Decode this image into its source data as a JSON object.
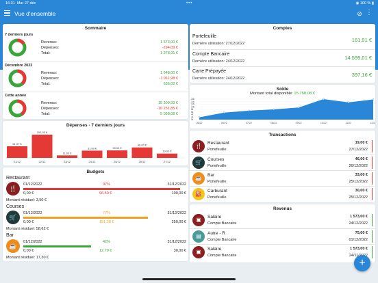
{
  "status": {
    "time": "16:31",
    "date": "Mar 27 déc",
    "dots": "•••",
    "battery": "100 %"
  },
  "appbar": {
    "title": "Vue d'ensemble",
    "notif_icon": "notifications-off-icon",
    "more_icon": "more-vertical-icon"
  },
  "sommaire": {
    "title": "Sommaire",
    "labels": {
      "revenus": "Revenus:",
      "depenses": "Dépenses:",
      "total": "Total:"
    },
    "periods": [
      {
        "name": "7 derniers jours",
        "revenus": "1 573,00 €",
        "depenses": "-294,09 €",
        "total": "1 278,91 €",
        "ratio": 0.16
      },
      {
        "name": "Décembre 2022",
        "revenus": "1 648,00 €",
        "depenses": "-1 011,98 €",
        "total": "636,02 €",
        "ratio": 0.38
      },
      {
        "name": "Cette année",
        "revenus": "15 309,93 €",
        "depenses": "-10 251,85 €",
        "total": "5 058,08 €",
        "ratio": 0.4
      }
    ]
  },
  "depenses": {
    "title": "Dépenses - 7 derniers jours",
    "chart_data": {
      "type": "bar",
      "categories": [
        "21/12",
        "22/12",
        "23/12",
        "24/12",
        "25/12",
        "26/12",
        "27/12"
      ],
      "values": [
        51.07,
        102.03,
        11.0,
        31.89,
        33.0,
        46.0,
        19.0
      ],
      "labels": [
        "51,07 €",
        "102,03 €",
        "11,00 €",
        "31,89 €",
        "33,00 €",
        "46,00 €",
        "19,00 €"
      ],
      "color": "#e53935"
    }
  },
  "budgets": {
    "title": "Budgets",
    "residuel_label": "Montant résiduel:",
    "items": [
      {
        "name": "Restaurant",
        "start": "01/12/2022",
        "end": "31/12/2022",
        "pct": "97%",
        "spent": "96,50 €",
        "min": "0,00 €",
        "total": "100,00 €",
        "residual": "3,50 €",
        "fill": 0.97,
        "color": "#e53935",
        "icon": "restaurant-icon",
        "icon_bg": "#8b1e1e"
      },
      {
        "name": "Courses",
        "start": "01/12/2022",
        "end": "31/12/2022",
        "pct": "77%",
        "spent": "191,38 €",
        "min": "0,00 €",
        "total": "250,00 €",
        "residual": "58,62 €",
        "fill": 0.77,
        "color": "#f0a020",
        "icon": "shopping-cart-icon",
        "icon_bg": "#1f3a3a"
      },
      {
        "name": "Bar",
        "start": "01/12/2022",
        "end": "31/12/2022",
        "pct": "42%",
        "spent": "12,70 €",
        "min": "0,00 €",
        "total": "30,00 €",
        "residual": "17,30 €",
        "fill": 0.42,
        "color": "#3aa53a",
        "icon": "coffee-icon",
        "icon_bg": "#ef8c1a"
      }
    ]
  },
  "comptes": {
    "title": "Comptes",
    "items": [
      {
        "name": "Portefeuille",
        "last": "Dernière utilisation: 27/12/2022",
        "value": "161,91 €"
      },
      {
        "name": "Compte Bancaire",
        "last": "Dernière utilisation: 24/12/2022",
        "value": "14 599,01 €"
      },
      {
        "name": "Carte Prépayée",
        "last": "Dernière utilisation: 24/12/2022",
        "value": "397,16 €"
      }
    ]
  },
  "solde": {
    "title": "Solde",
    "total_label": "Montant total disponible:",
    "total_value": "15 758,08 €",
    "chart_data": {
      "type": "area",
      "x": [
        "05/22",
        "06/22",
        "07/22",
        "08/22",
        "09/22",
        "10/22",
        "11/22",
        "12/22"
      ],
      "y": [
        1800,
        5500,
        7000,
        8000,
        9500,
        16000,
        13500,
        15758
      ],
      "ytick_labels": [
        "0k",
        "2k",
        "4k",
        "6k",
        "8k",
        "10k",
        "12k",
        "14k",
        "16k"
      ],
      "ylim": [
        0,
        16000
      ],
      "color": "#2a87d8"
    }
  },
  "transactions": {
    "title": "Transactions",
    "items": [
      {
        "name": "Restaurant",
        "account": "Portefeuille",
        "amount": "19,00 €",
        "date": "27/12/2022",
        "icon": "restaurant-icon",
        "icon_bg": "#8b1e1e",
        "color": "#e53935"
      },
      {
        "name": "Courses",
        "account": "Portefeuille",
        "amount": "46,00 €",
        "date": "26/12/2022",
        "icon": "shopping-cart-icon",
        "icon_bg": "#1f3a3a",
        "color": "#e53935"
      },
      {
        "name": "Bar",
        "account": "Portefeuille",
        "amount": "33,00 €",
        "date": "25/12/2022",
        "icon": "coffee-icon",
        "icon_bg": "#ef8c1a",
        "color": "#e53935"
      },
      {
        "name": "Carburant",
        "account": "Portefeuille",
        "amount": "30,00 €",
        "date": "25/12/2022",
        "icon": "fuel-icon",
        "icon_bg": "#f5c518",
        "color": "#e53935"
      }
    ]
  },
  "revenus": {
    "title": "Revenus",
    "items": [
      {
        "name": "Salaire",
        "account": "Compte Bancaire",
        "amount": "1 573,00 €",
        "date": "24/12/2022",
        "icon": "wallet-icon",
        "icon_bg": "#8b1e1e",
        "color": "#3aa53a"
      },
      {
        "name": "Autre - R",
        "account": "Compte Bancaire",
        "amount": "75,00 €",
        "date": "01/12/2022",
        "icon": "document-icon",
        "icon_bg": "#4a9a9a",
        "color": "#3aa53a"
      },
      {
        "name": "Salaire",
        "account": "Compte Bancaire",
        "amount": "1 573,00 €",
        "date": "24/11/2022",
        "icon": "wallet-icon",
        "icon_bg": "#8b1e1e",
        "color": "#3aa53a"
      }
    ]
  },
  "fab": {
    "label": "+"
  }
}
